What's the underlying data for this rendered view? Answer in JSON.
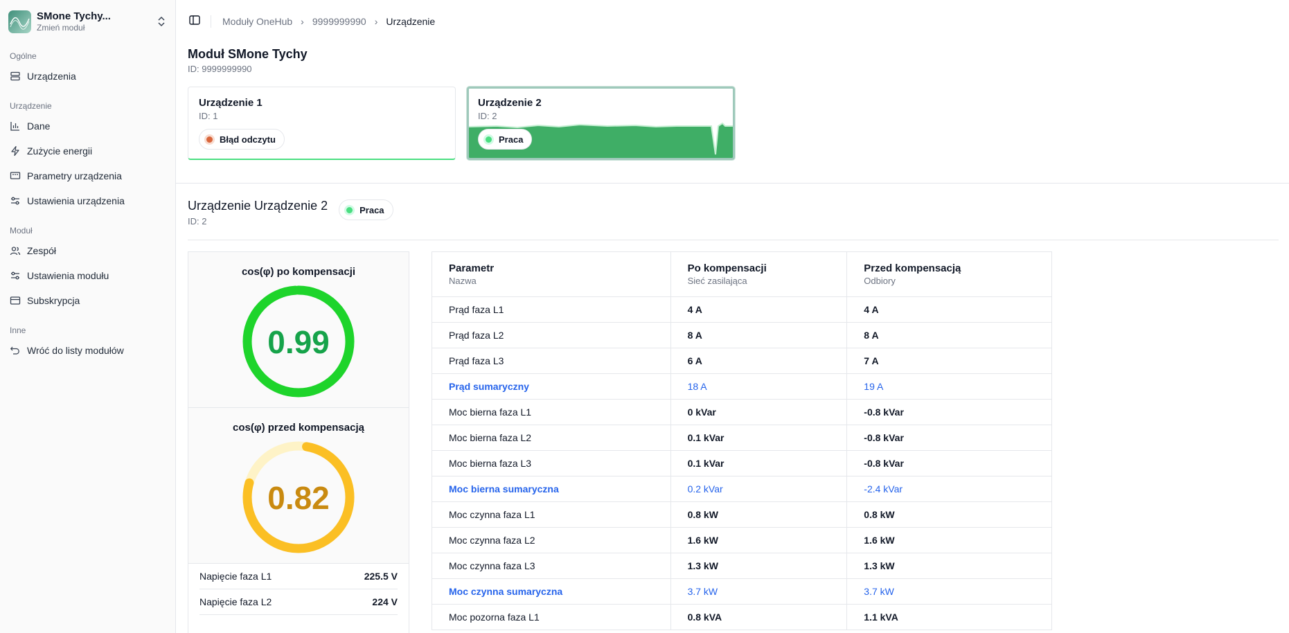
{
  "sidebar": {
    "module_name": "SMone Tychy...",
    "module_sub": "Zmień moduł",
    "groups": [
      {
        "label": "Ogólne",
        "items": [
          {
            "label": "Urządzenia",
            "icon": "server-icon"
          }
        ]
      },
      {
        "label": "Urządzenie",
        "items": [
          {
            "label": "Dane",
            "icon": "bar-chart-icon"
          },
          {
            "label": "Zużycie energii",
            "icon": "zap-icon"
          },
          {
            "label": "Parametry urządzenia",
            "icon": "monitor-icon"
          },
          {
            "label": "Ustawienia urządzenia",
            "icon": "sliders-icon"
          }
        ]
      },
      {
        "label": "Moduł",
        "items": [
          {
            "label": "Zespół",
            "icon": "users-icon"
          },
          {
            "label": "Ustawienia modułu",
            "icon": "sliders-icon"
          },
          {
            "label": "Subskrypcja",
            "icon": "credit-card-icon"
          }
        ]
      },
      {
        "label": "Inne",
        "items": [
          {
            "label": "Wróć do listy modułów",
            "icon": "undo-icon"
          }
        ]
      }
    ]
  },
  "breadcrumb": [
    "Moduły OneHub",
    "9999999990",
    "Urządzenie"
  ],
  "page": {
    "title": "Moduł SMone Tychy",
    "id": "ID: 9999999990"
  },
  "devices": [
    {
      "title": "Urządzenie 1",
      "id": "ID: 1",
      "status": "Błąd odczytu",
      "status_color": "#d9653b"
    },
    {
      "title": "Urządzenie 2",
      "id": "ID: 2",
      "status": "Praca",
      "status_color": "#4ade80"
    }
  ],
  "section": {
    "title": "Urządzenie Urządzenie 2",
    "id": "ID: 2",
    "status": "Praca"
  },
  "gauges": [
    {
      "label": "cos(φ) po kompensacji",
      "value": "0.99",
      "fraction": 0.99,
      "color": "#1ed42b",
      "track": "#dcfce7"
    },
    {
      "label": "cos(φ) przed kompensacją",
      "value": "0.82",
      "fraction": 0.82,
      "color": "#fbbf24",
      "track": "#fef3c7",
      "text_color": "#c98a10"
    }
  ],
  "voltages": [
    {
      "label": "Napięcie faza L1",
      "value": "225.5 V"
    },
    {
      "label": "Napięcie faza L2",
      "value": "224 V"
    }
  ],
  "table": {
    "headers": [
      {
        "title": "Parametr",
        "sub": "Nazwa"
      },
      {
        "title": "Po kompensacji",
        "sub": "Sieć zasilająca"
      },
      {
        "title": "Przed kompensacją",
        "sub": "Odbiory"
      }
    ],
    "rows": [
      {
        "name": "Prąd faza L1",
        "after": "4 A",
        "before": "4 A",
        "sum": false
      },
      {
        "name": "Prąd faza L2",
        "after": "8 A",
        "before": "8 A",
        "sum": false
      },
      {
        "name": "Prąd faza L3",
        "after": "6 A",
        "before": "7 A",
        "sum": false
      },
      {
        "name": "Prąd sumaryczny",
        "after": "18 A",
        "before": "19 A",
        "sum": true
      },
      {
        "name": "Moc bierna faza L1",
        "after": "0 kVar",
        "before": "-0.8 kVar",
        "sum": false
      },
      {
        "name": "Moc bierna faza L2",
        "after": "0.1 kVar",
        "before": "-0.8 kVar",
        "sum": false
      },
      {
        "name": "Moc bierna faza L3",
        "after": "0.1 kVar",
        "before": "-0.8 kVar",
        "sum": false
      },
      {
        "name": "Moc bierna sumaryczna",
        "after": "0.2 kVar",
        "before": "-2.4 kVar",
        "sum": true
      },
      {
        "name": "Moc czynna faza L1",
        "after": "0.8 kW",
        "before": "0.8 kW",
        "sum": false
      },
      {
        "name": "Moc czynna faza L2",
        "after": "1.6 kW",
        "before": "1.6 kW",
        "sum": false
      },
      {
        "name": "Moc czynna faza L3",
        "after": "1.3 kW",
        "before": "1.3 kW",
        "sum": false
      },
      {
        "name": "Moc czynna sumaryczna",
        "after": "3.7 kW",
        "before": "3.7 kW",
        "sum": true
      },
      {
        "name": "Moc pozorna faza L1",
        "after": "0.8 kVA",
        "before": "1.1 kVA",
        "sum": false
      }
    ]
  }
}
